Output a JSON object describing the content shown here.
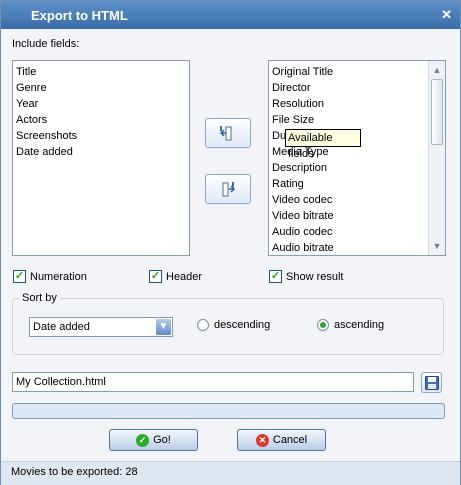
{
  "window": {
    "title": "Export to HTML",
    "close_glyph": "✕"
  },
  "include_fields_label": "Include fields:",
  "included_fields": [
    "Title",
    "Genre",
    "Year",
    "Actors",
    "Screenshots",
    "Date added"
  ],
  "available_fields": [
    "Original Title",
    "Director",
    "Resolution",
    "File Size",
    "Du",
    "Media Type",
    "Description",
    "Rating",
    "Video codec",
    "Video bitrate",
    "Audio codec",
    "Audio bitrate"
  ],
  "tooltip": "Available fields",
  "move_buttons": {
    "add_icon": "move-right-icon",
    "remove_icon": "move-left-icon"
  },
  "options": {
    "numeration": {
      "label": "Numeration",
      "checked": true
    },
    "header": {
      "label": "Header",
      "checked": true
    },
    "show_result": {
      "label": "Show result",
      "checked": true
    }
  },
  "sort": {
    "group_label": "Sort by",
    "selected": "Date added",
    "descending_label": "descending",
    "ascending_label": "ascending",
    "order": "ascending"
  },
  "file": {
    "value": "My Collection.html"
  },
  "progress": 0,
  "buttons": {
    "go_label": "Go!",
    "cancel_label": "Cancel"
  },
  "status": {
    "text": "Movies to be exported: 28"
  },
  "colors": {
    "accent": "#3a6da8",
    "check": "#21a121",
    "cancel": "#d93a2b"
  }
}
